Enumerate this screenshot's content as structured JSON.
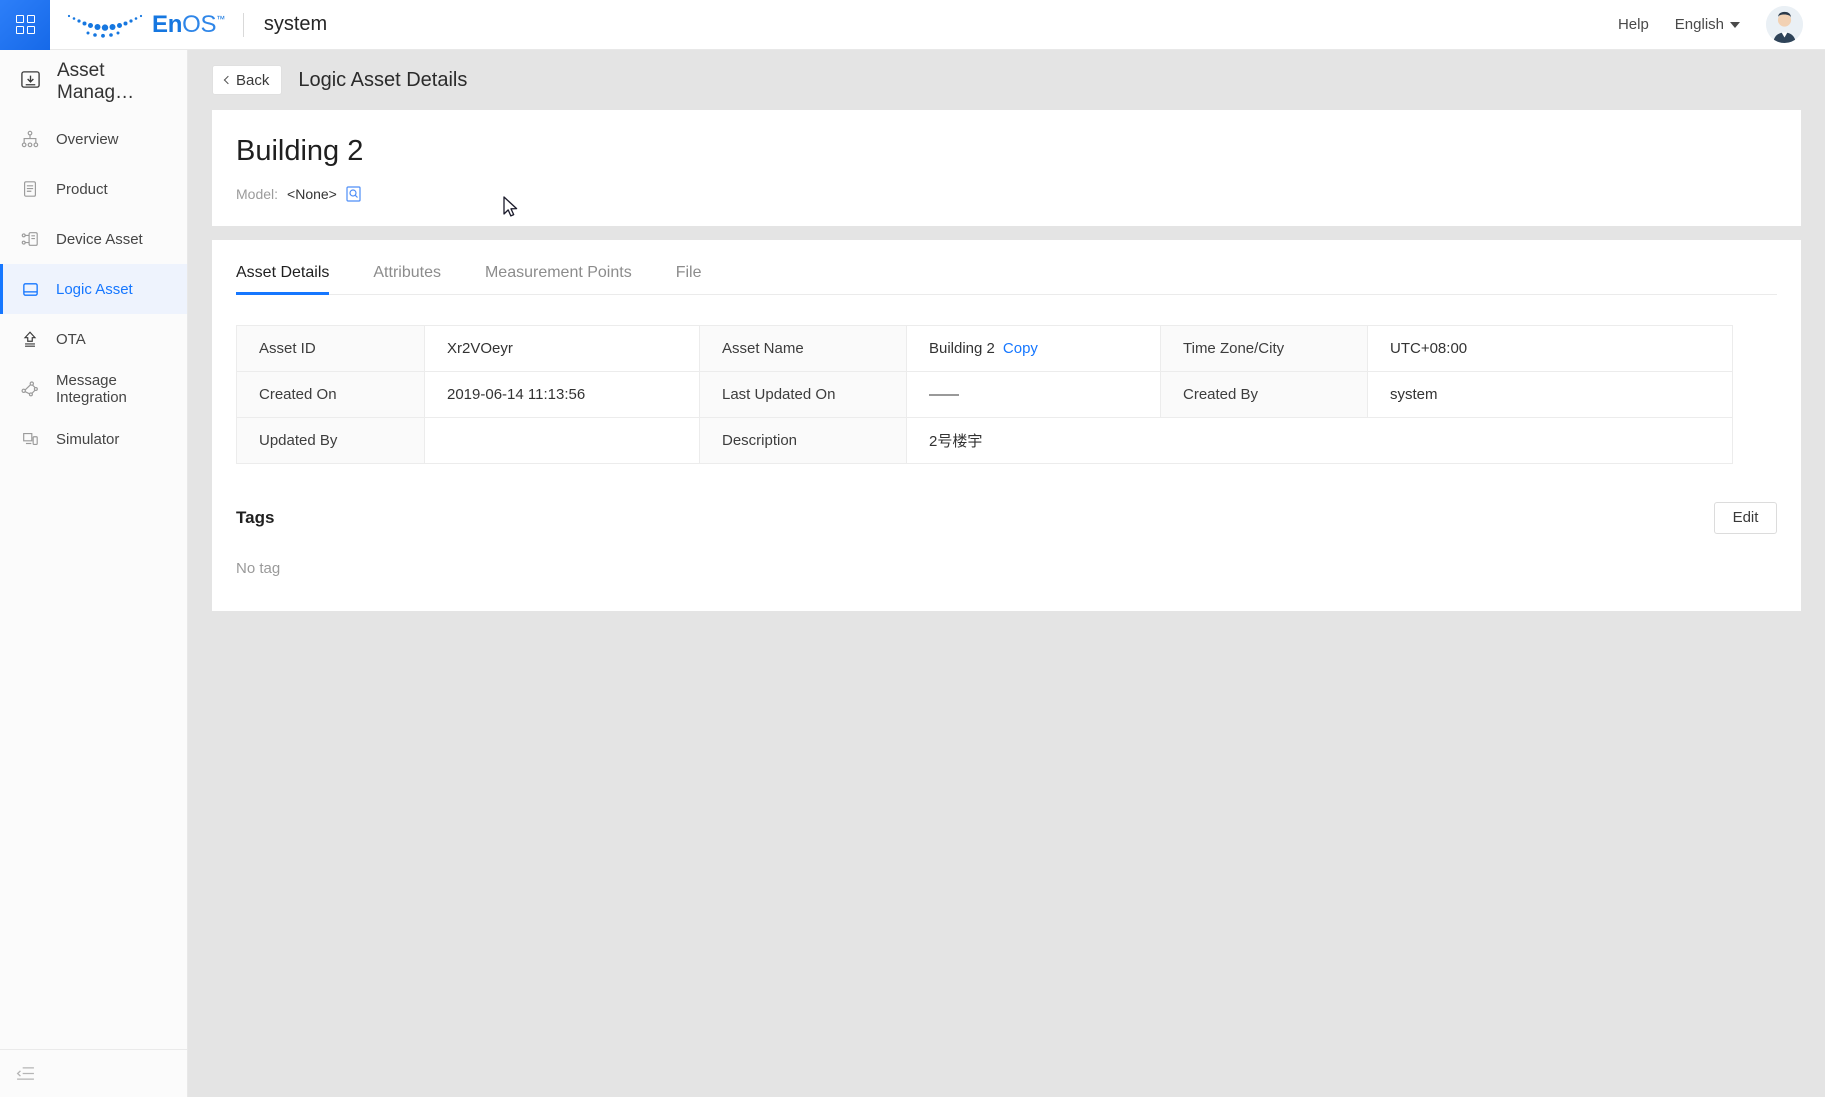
{
  "topbar": {
    "apps_icon": "grid-apps-icon",
    "logo_text_bold": "En",
    "logo_text_light": "OS",
    "logo_tm": "™",
    "system_name": "system",
    "help_label": "Help",
    "language_label": "English",
    "avatar_icon": "user-avatar"
  },
  "sidebar": {
    "title": "Asset Manag…",
    "title_icon": "asset-management-icon",
    "items": [
      {
        "label": "Overview",
        "icon": "hierarchy-icon",
        "active": false
      },
      {
        "label": "Product",
        "icon": "document-icon",
        "active": false
      },
      {
        "label": "Device Asset",
        "icon": "device-asset-icon",
        "active": false
      },
      {
        "label": "Logic Asset",
        "icon": "logic-asset-icon",
        "active": true
      },
      {
        "label": "OTA",
        "icon": "upload-arrow-icon",
        "active": false
      },
      {
        "label": "Message Integration",
        "icon": "message-integration-icon",
        "active": false
      },
      {
        "label": "Simulator",
        "icon": "simulator-icon",
        "active": false
      }
    ],
    "collapse_icon": "collapse-sidebar-icon"
  },
  "page": {
    "back_label": "Back",
    "back_icon": "chevron-left-icon",
    "title": "Logic Asset Details"
  },
  "asset": {
    "name": "Building 2",
    "model_label": "Model:",
    "model_value": "<None>",
    "model_icon": "model-lookup-icon"
  },
  "tabs": [
    {
      "label": "Asset Details",
      "active": true
    },
    {
      "label": "Attributes",
      "active": false
    },
    {
      "label": "Measurement Points",
      "active": false
    },
    {
      "label": "File",
      "active": false
    }
  ],
  "details_table": {
    "rows": [
      [
        {
          "type": "label",
          "text": "Asset ID"
        },
        {
          "type": "value",
          "text": "Xr2VOeyr"
        },
        {
          "type": "label",
          "text": "Asset Name"
        },
        {
          "type": "value",
          "text": "Building 2",
          "link": "Copy"
        },
        {
          "type": "label",
          "text": "Time Zone/City"
        },
        {
          "type": "value",
          "text": "UTC+08:00"
        }
      ],
      [
        {
          "type": "label",
          "text": "Created On"
        },
        {
          "type": "value",
          "text": "2019-06-14 11:13:56"
        },
        {
          "type": "label",
          "text": "Last Updated On"
        },
        {
          "type": "value",
          "text": "——"
        },
        {
          "type": "label",
          "text": "Created By"
        },
        {
          "type": "value",
          "text": "system"
        }
      ],
      [
        {
          "type": "label",
          "text": "Updated By"
        },
        {
          "type": "value",
          "text": ""
        },
        {
          "type": "label",
          "text": "Description"
        },
        {
          "type": "value",
          "text": "2号楼宇",
          "colspan": 3
        }
      ]
    ]
  },
  "tags": {
    "title": "Tags",
    "edit_label": "Edit",
    "empty_text": "No tag"
  },
  "colors": {
    "accent": "#1677ff",
    "page_bg": "#e4e4e4",
    "card_bg": "#ffffff",
    "sidebar_bg": "#fbfbfb",
    "label_cell_bg": "#fafafa",
    "muted_text": "#9a9a9a"
  }
}
